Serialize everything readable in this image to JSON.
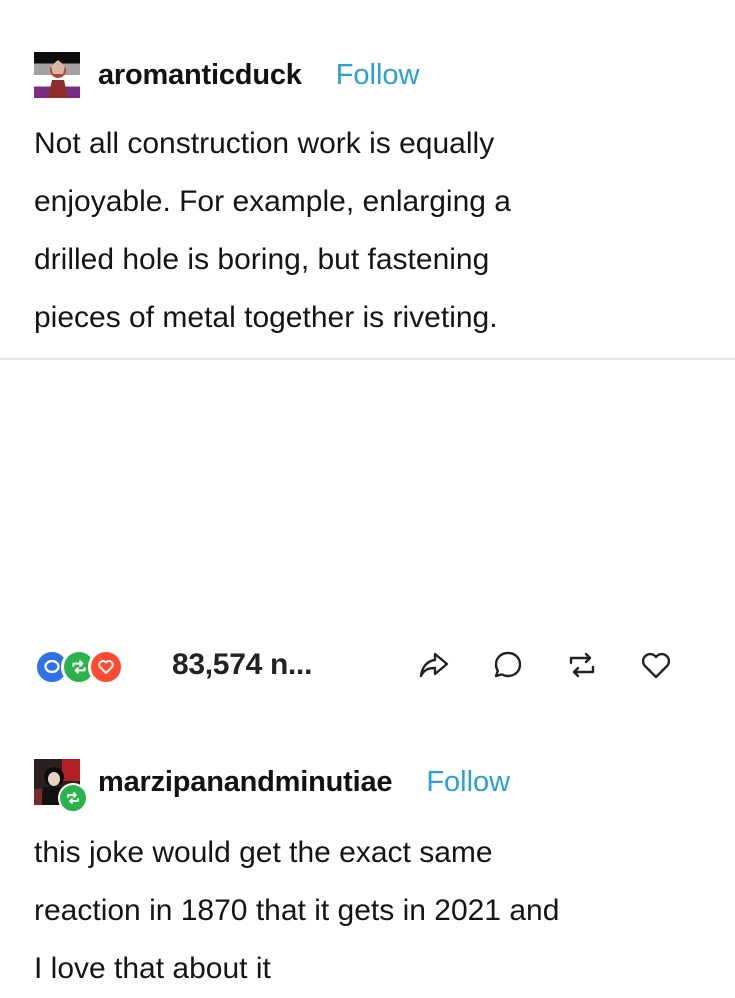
{
  "posts": [
    {
      "username": "aromanticduck",
      "follow_label": "Follow",
      "text": "Not all construction work is equally\nenjoyable. For example, enlarging a\ndrilled hole is boring, but fastening\npieces of metal together is riveting."
    },
    {
      "username": "marzipanandminutiae",
      "follow_label": "Follow",
      "text": "this joke would get the exact same\nreaction in 1870 that it gets in 2021 and\nI love that about it",
      "reblogged": true
    }
  ],
  "footer": {
    "notes_count": "83,574 n...",
    "note_avatars": [
      {
        "icon": "reply-bubble-icon",
        "color": "#2f72e8"
      },
      {
        "icon": "reblog-icon",
        "color": "#2bb24c"
      },
      {
        "icon": "heart-icon",
        "color": "#ff4930"
      }
    ],
    "actions": [
      "share-icon",
      "reply-icon",
      "reblog-icon",
      "like-icon"
    ]
  },
  "colors": {
    "follow": "#2aa2cf",
    "divider": "#e6e6e6",
    "reblog_green": "#2bb24c"
  }
}
